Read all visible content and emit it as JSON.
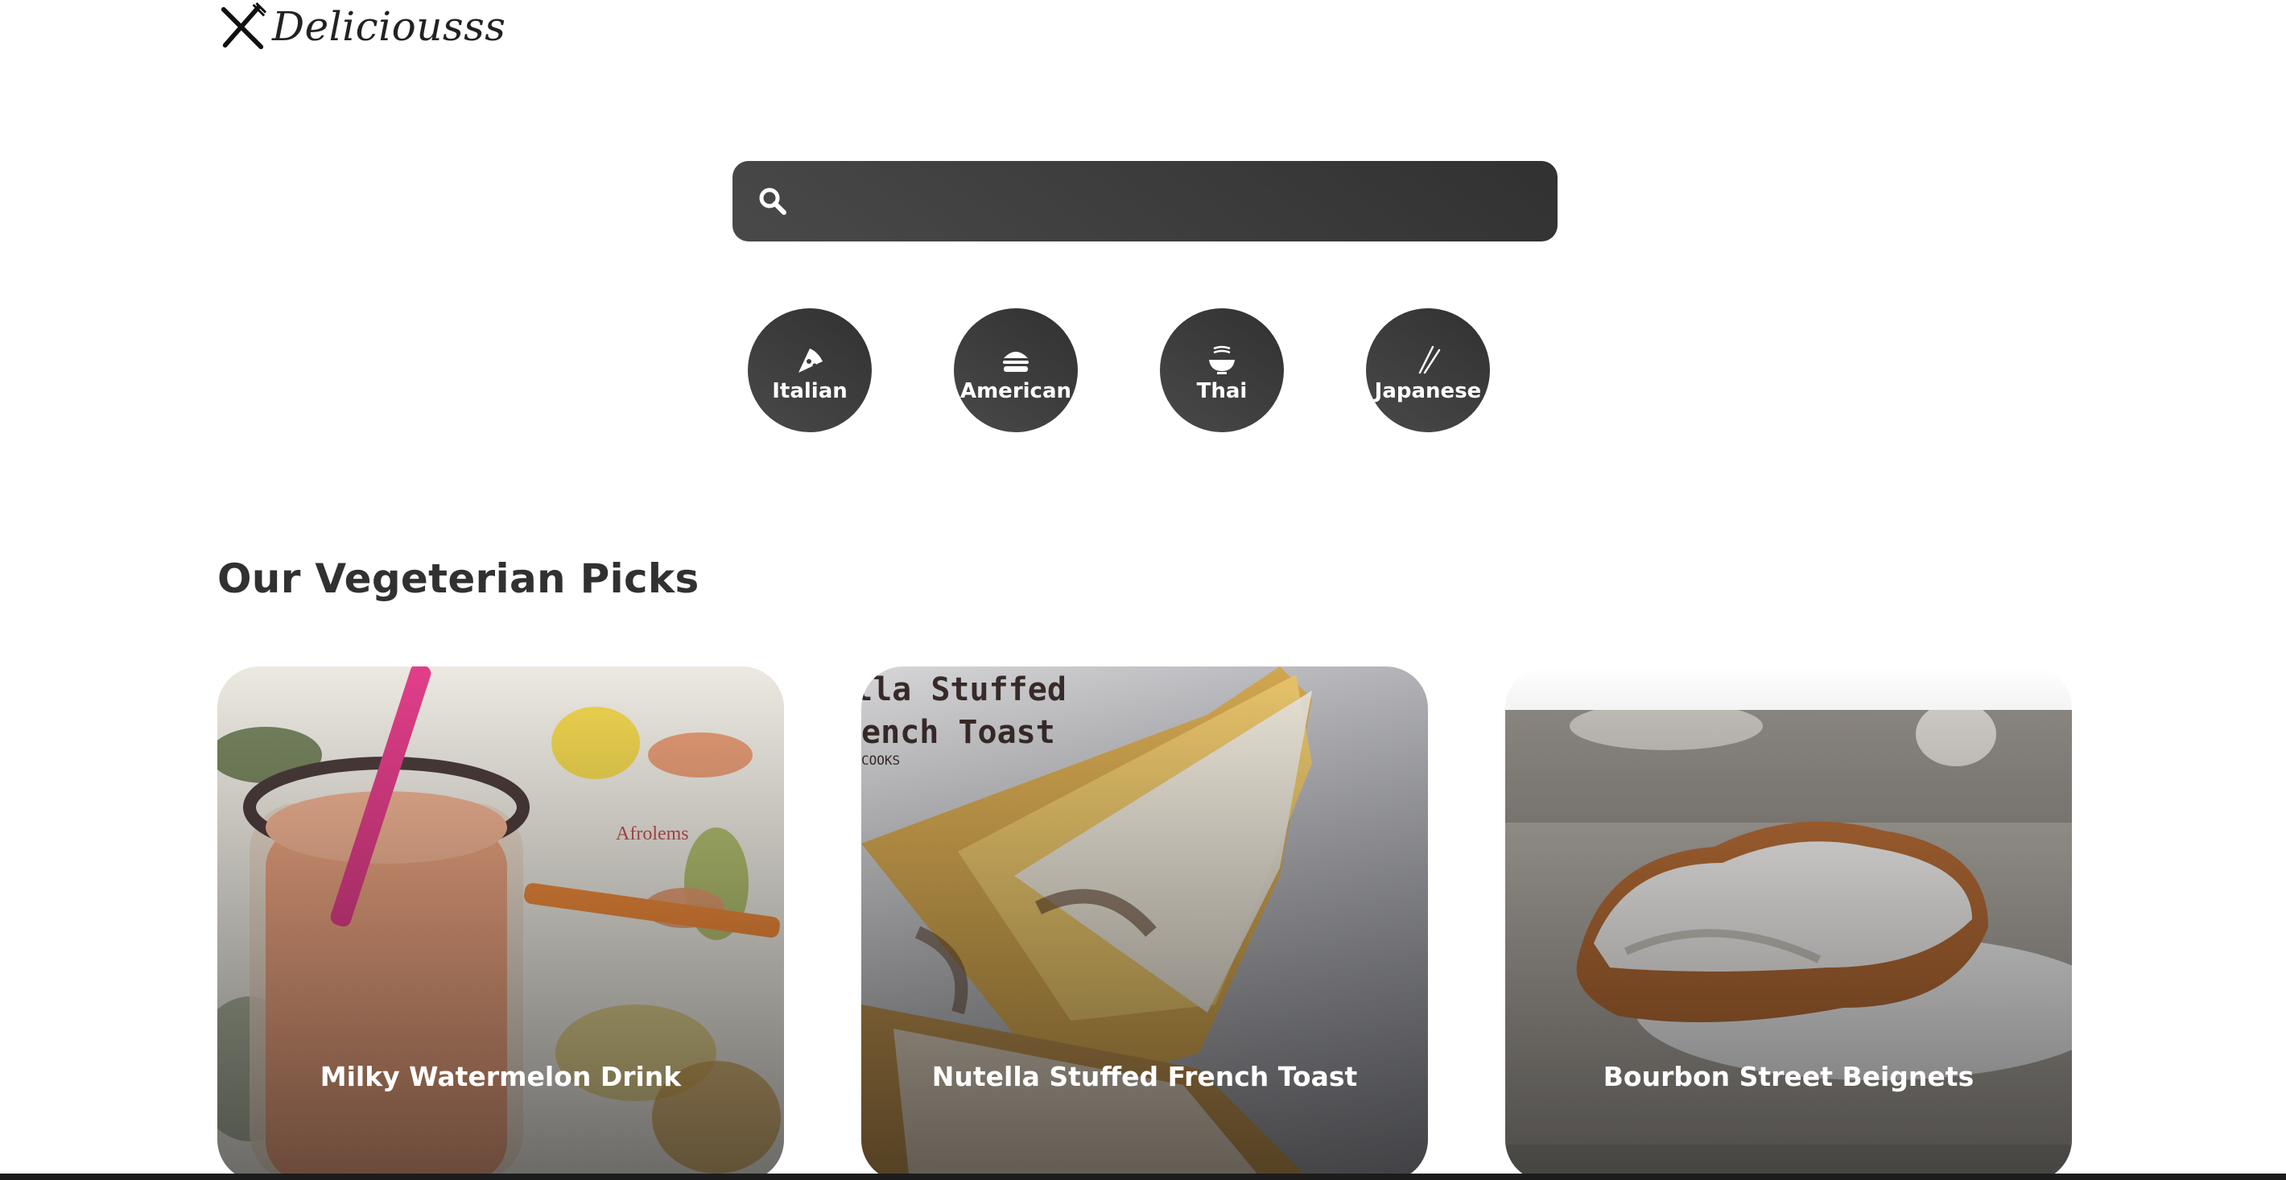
{
  "logo": {
    "text": "Deliciousss",
    "icon": "fork-knife-icon"
  },
  "search": {
    "value": "",
    "placeholder": "",
    "icon": "search-icon"
  },
  "categories": [
    {
      "label": "Italian",
      "icon": "pizza-icon"
    },
    {
      "label": "American",
      "icon": "hamburger-icon"
    },
    {
      "label": "Thai",
      "icon": "noodle-bowl-icon"
    },
    {
      "label": "Japanese",
      "icon": "chopsticks-icon"
    }
  ],
  "section": {
    "title": "Our Vegeterian Picks"
  },
  "cards": [
    {
      "title": "Milky Watermelon Drink",
      "image_text": "Afrolems"
    },
    {
      "title": "Nutella Stuffed French Toast",
      "image_text": [
        "lla Stuffed",
        "ench Toast",
        "COOKS"
      ]
    },
    {
      "title": "Bourbon Street Beignets"
    }
  ],
  "colors": {
    "dark_gradient_start": "#494949",
    "dark_gradient_end": "#313131",
    "text": "#313131"
  }
}
